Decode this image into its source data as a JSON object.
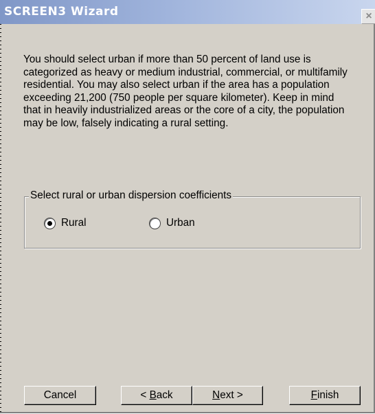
{
  "window": {
    "title": "SCREEN3 Wizard",
    "close_glyph": "×"
  },
  "description": "You should select urban if more than 50 percent of land use is categorized as heavy or medium industrial, commercial, or multifamily residential.  You may also select urban if the area has a population exceeding 21,200 (750 people per square kilometer).  Keep in mind that in heavily industrialized areas or the core of a city, the population may be low, falsely indicating a rural setting.",
  "dispersion": {
    "group_label": "Select rural or urban dispersion coefficients",
    "selected": "Rural",
    "options": [
      "Rural",
      "Urban"
    ]
  },
  "buttons": {
    "cancel": "Cancel",
    "back_prefix": "< ",
    "back_mnemonic": "B",
    "back_rest": "ack",
    "next_mnemonic": "N",
    "next_rest": "ext >",
    "finish_mnemonic": "F",
    "finish_rest": "inish"
  },
  "colors": {
    "dialog_background": "#d4d0c8",
    "titlebar_start": "#8097c7",
    "titlebar_end": "#c9d6ee"
  }
}
